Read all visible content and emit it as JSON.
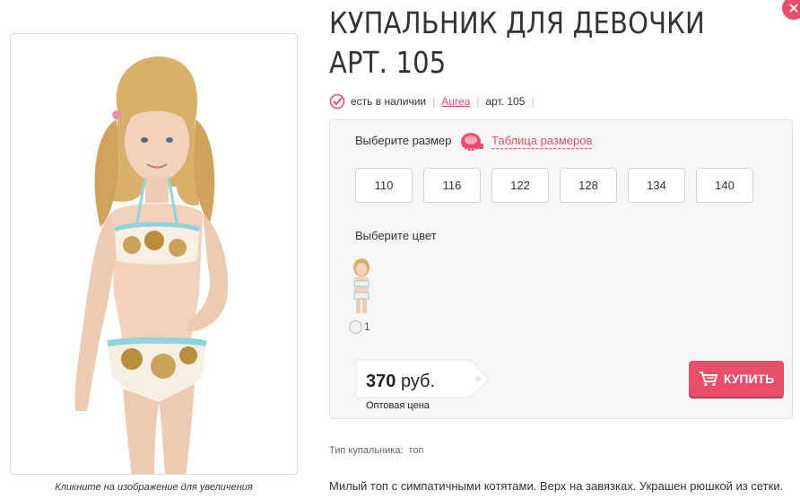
{
  "close": {
    "glyph": "×"
  },
  "gallery": {
    "caption": "Кликните на изображение для увеличения",
    "zoom_icon": "magnifier-icon"
  },
  "product": {
    "title": "КУПАЛЬНИК ДЛЯ ДЕВОЧКИ АРТ. 105",
    "availability": "есть в наличии",
    "brand": "Aurea",
    "article": "арт. 105",
    "sep": "|"
  },
  "options": {
    "size_label": "Выберите размер",
    "size_table_link": "Таблица размеров",
    "sizes": [
      "110",
      "116",
      "122",
      "128",
      "134",
      "140"
    ],
    "color_label": "Выберите цвет",
    "color_option_label": "1"
  },
  "price": {
    "value": "370",
    "currency": "руб.",
    "note": "Оптовая цена"
  },
  "buy": {
    "label": "КУПИТЬ"
  },
  "specs": {
    "type_label": "Тип купальника:",
    "type_value": "топ"
  },
  "description": "Милый топ с симпатичными котятами. Верх на завязках. Украшен рюшкой из сетки.",
  "colors": {
    "accent": "#e84d6a",
    "panel": "#f6f6f6",
    "border": "#dddddd"
  }
}
